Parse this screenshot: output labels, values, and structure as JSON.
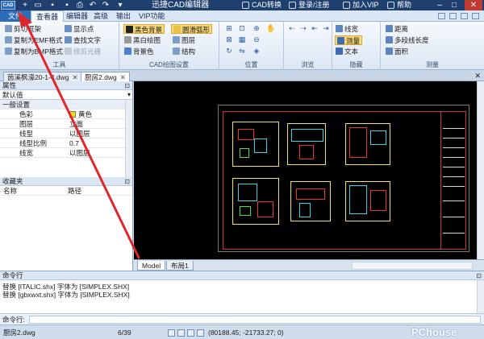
{
  "titlebar": {
    "logo_text": "CAD",
    "app_title": "迅捷CAD编辑器",
    "links": [
      "CAD转换",
      "登录/注册",
      "加入VIP",
      "帮助"
    ]
  },
  "menubar": {
    "file": "文件",
    "items": [
      "查看器",
      "编辑器",
      "高级",
      "输出",
      "VIP功能"
    ]
  },
  "ribbon": {
    "tools": {
      "label": "工具",
      "buttons": [
        "剪切框架",
        "复制为EMF格式",
        "复制为BMP格式",
        "显示点",
        "查找文字",
        "修剪光栅"
      ]
    },
    "cad_settings": {
      "label": "CAD绘图设置",
      "buttons": [
        "黑色背景",
        "圆滑弧形",
        "黑白绘图",
        "图层",
        "背景色",
        "结构"
      ]
    },
    "position": {
      "label": "位置"
    },
    "browse": {
      "label": "浏览"
    },
    "hide": {
      "label": "隐藏",
      "buttons": [
        "线宽",
        "测量",
        "文本"
      ]
    },
    "measure": {
      "label": "测量",
      "buttons": [
        "距离",
        "多段线长度",
        "面积"
      ]
    }
  },
  "doctabs": [
    "茵溪枫濠20-1-4.dwg",
    "厨房2.dwg"
  ],
  "properties": {
    "title": "属性",
    "selector": "默认值",
    "category": "一般设置",
    "rows": [
      {
        "k": "色彩",
        "v": "黄色"
      },
      {
        "k": "图层",
        "v": "立面"
      },
      {
        "k": "线型",
        "v": "以图层"
      },
      {
        "k": "线型比例",
        "v": "0.7"
      },
      {
        "k": "线宽",
        "v": "以图层"
      }
    ]
  },
  "favorites": {
    "title": "收藏夹",
    "col_name": "名称",
    "col_path": "路径"
  },
  "model_tabs": [
    "Model",
    "布局1"
  ],
  "command": {
    "title": "命令行",
    "log": [
      "替换 [ITALIC.shx] 字体为 [SIMPLEX.SHX]",
      "替换 [gbxwxt.shx] 字体为 [SIMPLEX.SHX]"
    ],
    "prompt_label": "命令行:"
  },
  "status": {
    "file": "厨房2.dwg",
    "page": "6/39",
    "coords": "(80188.45; -21733.27; 0)",
    "watermark": "PChouse"
  },
  "colors": {
    "accent": "#2d6db8",
    "title_bg": "#1f3f6e",
    "arrow": "#e0252b",
    "canvas_bg": "#000000"
  }
}
